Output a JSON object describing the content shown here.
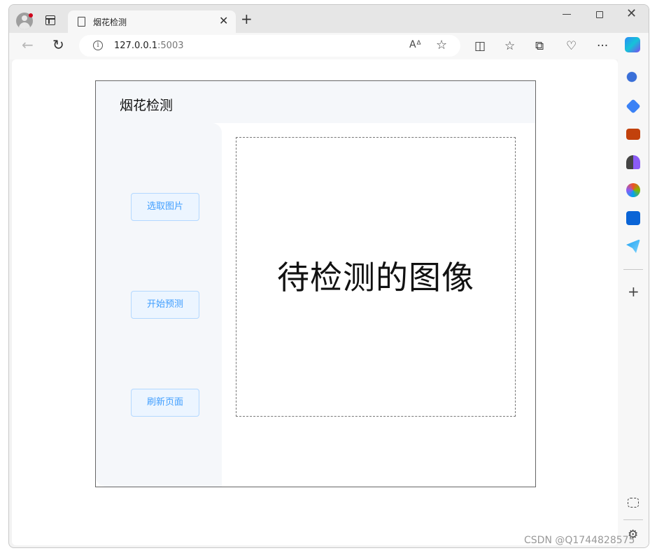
{
  "browser": {
    "tab_title": "烟花检测",
    "tab_close": "✕",
    "new_tab": "+",
    "url_host": "127.0.0.1",
    "url_port": ":5003",
    "read_aloud": "Aᐞ",
    "window_close": "✕"
  },
  "app": {
    "title": "烟花检测",
    "buttons": {
      "select_image": "选取图片",
      "start_predict": "开始预测",
      "refresh_page": "刷新页面"
    },
    "preview_placeholder": "待检测的图像"
  },
  "sidebar": {
    "icons": [
      "search-icon",
      "tag-icon",
      "toolbox-icon",
      "chess-icon",
      "office-icon",
      "outlook-icon",
      "telegram-icon",
      "screenshot-icon",
      "settings-icon"
    ],
    "add": "+"
  },
  "watermark": "CSDN @Q1744828575"
}
